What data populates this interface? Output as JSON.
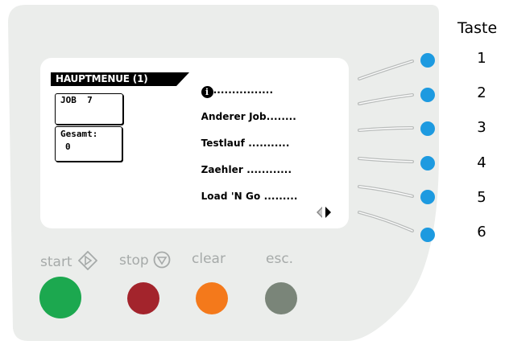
{
  "colors": {
    "panel": "#ebedeb",
    "screen": "#ffffff",
    "soft_key": "#1d9ae0",
    "start": "#1ca84f",
    "stop": "#a3242c",
    "clear": "#f4791b",
    "esc": "#7a8579",
    "label_gray": "#a6aaa9"
  },
  "display": {
    "header": "HAUPTMENUE (1)",
    "job_box": "JOB  7",
    "total_box_label": "Gesamt:",
    "total_box_value": "0",
    "menu_items": [
      {
        "label": "",
        "dots": "................",
        "icon": "info-icon"
      },
      {
        "label": "Anderer Job",
        "dots": "........"
      },
      {
        "label": "Testlauf",
        "dots": "..........."
      },
      {
        "label": "Zaehler",
        "dots": "............"
      },
      {
        "label": "Load 'N Go",
        "dots": "........."
      }
    ],
    "page_nav_icon": "left-right-arrows-icon"
  },
  "softkeys": {
    "title": "Taste",
    "numbers": [
      "1",
      "2",
      "3",
      "4",
      "5",
      "6"
    ]
  },
  "controls": {
    "start": {
      "label": "start",
      "icon": "diamond-arrow-icon"
    },
    "stop": {
      "label": "stop",
      "icon": "circle-triangle-icon"
    },
    "clear": {
      "label": "clear"
    },
    "esc": {
      "label": "esc."
    }
  }
}
